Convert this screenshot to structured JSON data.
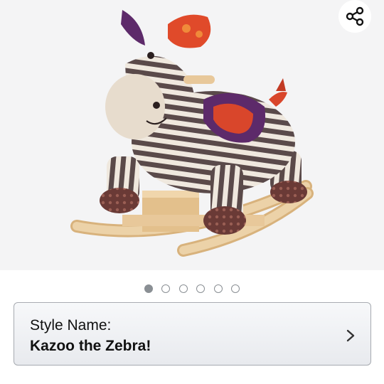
{
  "product": {
    "image_alt": "Striped plush zebra rocking horse on wooden rockers"
  },
  "share": {
    "icon": "share-icon"
  },
  "carousel": {
    "count": 6,
    "active_index": 0
  },
  "style_selector": {
    "label": "Style Name:",
    "value": "Kazoo the Zebra!",
    "icon": "chevron-right-icon"
  },
  "colors": {
    "image_background": "#f4f4f5",
    "dot_color": "#8a8f94",
    "selector_border": "#a6aab0",
    "zebra_dark": "#5a4a4a",
    "zebra_light": "#efe8de",
    "saddle": "#5d2a6a",
    "accent_red": "#d9462b",
    "wood": "#e8c89a"
  }
}
